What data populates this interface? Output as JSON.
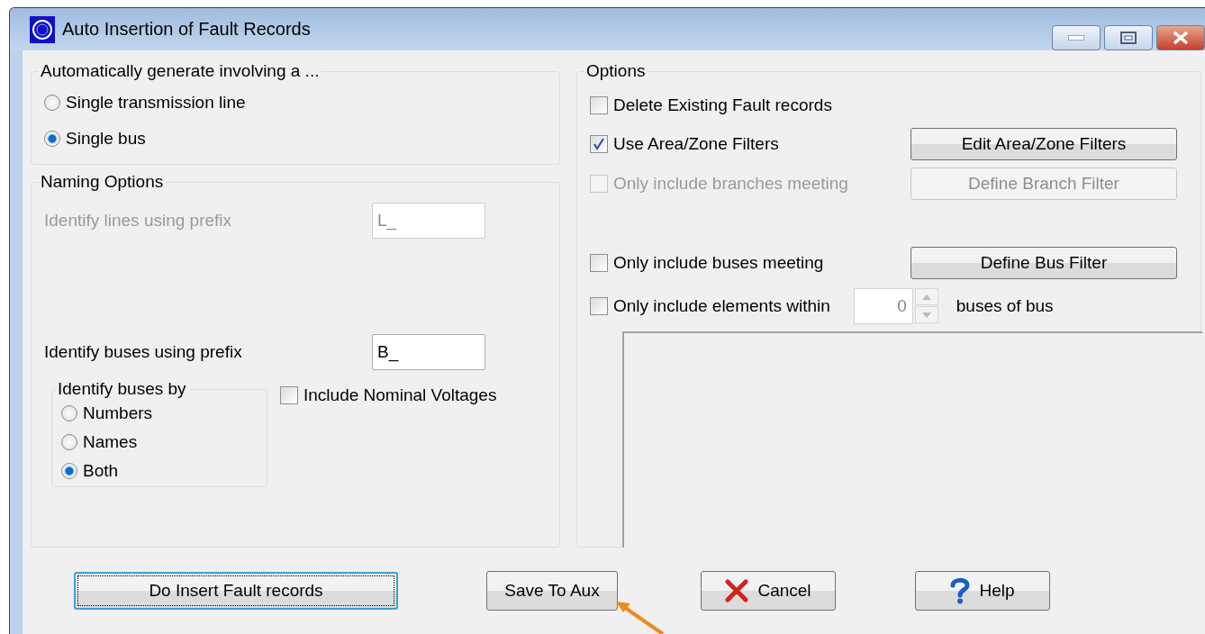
{
  "window": {
    "title": "Auto Insertion of Fault Records"
  },
  "generate_group": {
    "title": "Automatically generate involving a ...",
    "options": [
      {
        "label": "Single transmission line",
        "selected": false
      },
      {
        "label": "Single bus",
        "selected": true
      }
    ]
  },
  "naming_group": {
    "title": "Naming Options",
    "line_prefix": {
      "label": "Identify lines using prefix",
      "value": "L_",
      "disabled": true
    },
    "bus_prefix": {
      "label": "Identify buses using prefix",
      "value": "B_",
      "disabled": false
    },
    "identify_by": {
      "title": "Identify buses by",
      "options": [
        {
          "label": "Numbers",
          "selected": false
        },
        {
          "label": "Names",
          "selected": false
        },
        {
          "label": "Both",
          "selected": true
        }
      ]
    },
    "nominal_voltages": {
      "label": "Include Nominal Voltages",
      "checked": false
    }
  },
  "options_group": {
    "title": "Options",
    "filters": [
      {
        "kind": "check",
        "label": "Delete Existing Fault records",
        "checked": false,
        "disabled": false
      },
      {
        "kind": "button",
        "label": "Use Area/Zone Filters",
        "checked": true,
        "disabled": false,
        "button": "Edit Area/Zone Filters"
      },
      {
        "kind": "button",
        "label": "Only include branches meeting",
        "checked": false,
        "disabled": true,
        "button": "Define Branch Filter"
      }
    ],
    "limits": [
      {
        "kind": "button",
        "label": "Only include buses meeting",
        "checked": false,
        "disabled": false,
        "button": "Define Bus Filter"
      },
      {
        "kind": "spin",
        "label": "Only include elements within",
        "checked": false,
        "disabled": false,
        "value": "0",
        "suffix": "buses of bus"
      }
    ]
  },
  "buttons": [
    {
      "kind": "default",
      "label": "Do Insert Fault records"
    },
    {
      "kind": "plain",
      "label": "Save To Aux"
    },
    {
      "kind": "cancel",
      "label": "Cancel"
    },
    {
      "kind": "help",
      "label": "Help"
    }
  ]
}
